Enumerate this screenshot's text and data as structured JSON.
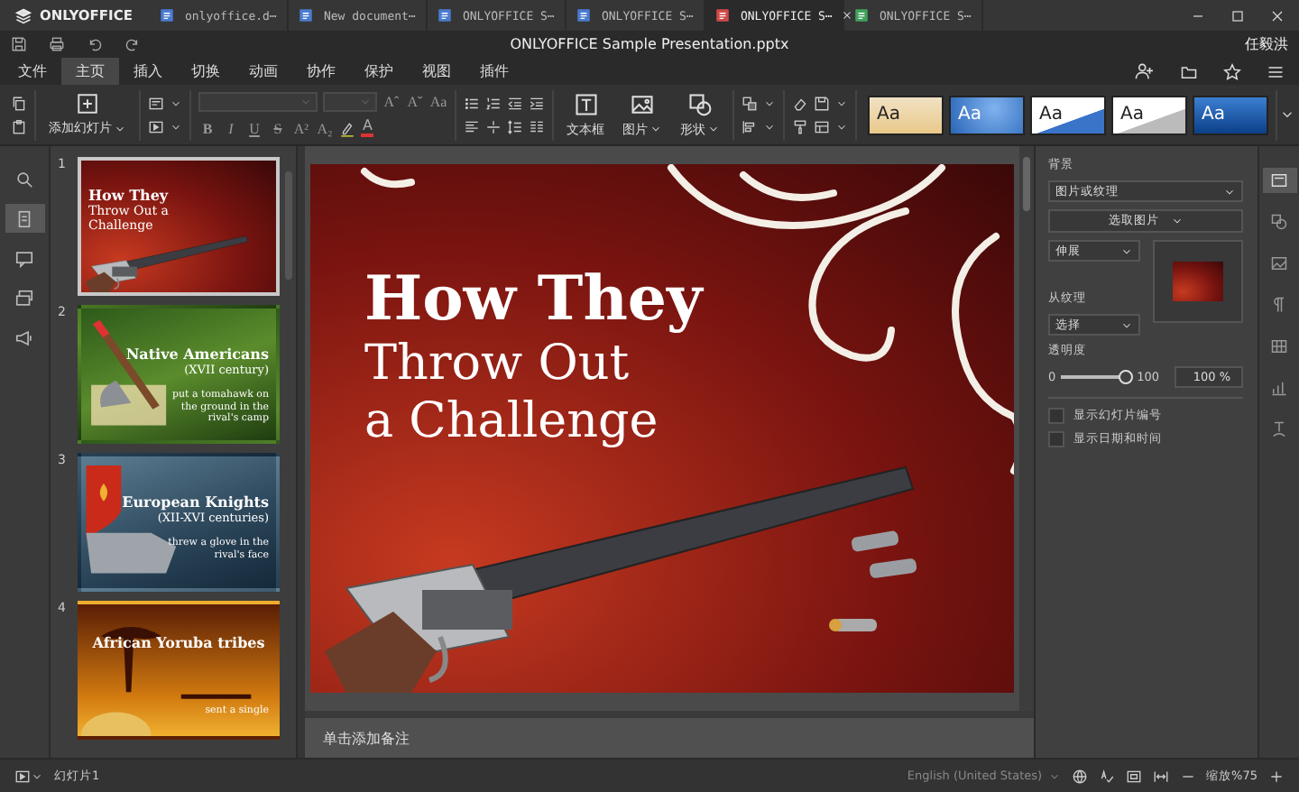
{
  "app_logo": "ONLYOFFICE",
  "tabs": [
    {
      "label": "onlyoffice.d⋯",
      "kind": "document",
      "selected": false
    },
    {
      "label": "New document⋯",
      "kind": "document",
      "selected": false
    },
    {
      "label": "ONLYOFFICE S⋯",
      "kind": "document",
      "selected": false
    },
    {
      "label": "ONLYOFFICE S⋯",
      "kind": "document",
      "selected": false
    },
    {
      "label": "ONLYOFFICE S⋯",
      "kind": "presentation",
      "selected": true
    },
    {
      "label": "ONLYOFFICE S⋯",
      "kind": "spreadsheet",
      "selected": false
    }
  ],
  "title": "ONLYOFFICE Sample Presentation.pptx",
  "user": "任毅洪",
  "menu": [
    {
      "label": "文件",
      "selected": false
    },
    {
      "label": "主页",
      "selected": true
    },
    {
      "label": "插入",
      "selected": false
    },
    {
      "label": "切换",
      "selected": false
    },
    {
      "label": "动画",
      "selected": false
    },
    {
      "label": "协作",
      "selected": false
    },
    {
      "label": "保护",
      "selected": false
    },
    {
      "label": "视图",
      "selected": false
    },
    {
      "label": "插件",
      "selected": false
    }
  ],
  "toolbar": {
    "add_slide": "添加幻灯片",
    "font_buttons": [
      "Aˆ",
      "Aˇ",
      "Aa"
    ],
    "format_buttons": [
      "B",
      "I",
      "U",
      "S",
      "A²",
      "A₂"
    ],
    "font_color": "A",
    "insert": [
      {
        "label": "文本框",
        "kind": "textbox"
      },
      {
        "label": "图片",
        "kind": "image"
      },
      {
        "label": "形状",
        "kind": "shape"
      }
    ],
    "themes": [
      {
        "label": "Aa",
        "kind": "sand"
      },
      {
        "label": "Aa",
        "kind": "blue-dots"
      },
      {
        "label": "Aa",
        "kind": "white-blue"
      },
      {
        "label": "Aa",
        "kind": "white-gray"
      },
      {
        "label": "Aa",
        "kind": "deep-blue"
      }
    ]
  },
  "left_rail": [
    {
      "kind": "search",
      "selected": false
    },
    {
      "kind": "slides",
      "selected": true
    },
    {
      "kind": "comments",
      "selected": false
    },
    {
      "kind": "chat",
      "selected": false
    },
    {
      "kind": "feedback",
      "selected": false
    }
  ],
  "slides": [
    {
      "number": "1",
      "selected": true,
      "kind": "challenge",
      "title": "How They",
      "subtitle": "Throw Out a Challenge"
    },
    {
      "number": "2",
      "selected": false,
      "kind": "americans",
      "title": "Native Americans",
      "subtitle": "(XVII century)",
      "body": "put a tomahawk on the ground in the rival's camp"
    },
    {
      "number": "3",
      "selected": false,
      "kind": "knights",
      "title": "European Knights",
      "subtitle": "(XII-XVI centuries)",
      "body": "threw a glove in the rival's face"
    },
    {
      "number": "4",
      "selected": false,
      "kind": "yoruba",
      "title": "African Yoruba tribes",
      "body": "sent a single"
    }
  ],
  "current_slide": {
    "title": "How They",
    "subtitle": "Throw Out a Challenge"
  },
  "notes": {
    "placeholder": "单击添加备注"
  },
  "background": {
    "heading": "背景",
    "fill": "图片或纹理",
    "pick_button": "选取图片",
    "stretch": "伸展",
    "texture_label": "从纹理",
    "texture": "选择",
    "opacity_label": "透明度",
    "opacity_min": "0",
    "opacity_max": "100",
    "opacity_slider": {
      "level": 1
    },
    "opacity_value": "100 %",
    "options": [
      {
        "label": "显示幻灯片编号",
        "checked": false
      },
      {
        "label": "显示日期和时间",
        "checked": false
      }
    ]
  },
  "right_rail": [
    {
      "kind": "slide",
      "selected": true
    },
    {
      "kind": "shape",
      "selected": false
    },
    {
      "kind": "image",
      "selected": false
    },
    {
      "kind": "paragraph",
      "selected": false
    },
    {
      "kind": "table",
      "selected": false
    },
    {
      "kind": "chart",
      "selected": false
    },
    {
      "kind": "textart",
      "selected": false
    }
  ],
  "status": {
    "slide": "幻灯片1",
    "language": "English (United States)",
    "zoom": "缩放%75"
  }
}
